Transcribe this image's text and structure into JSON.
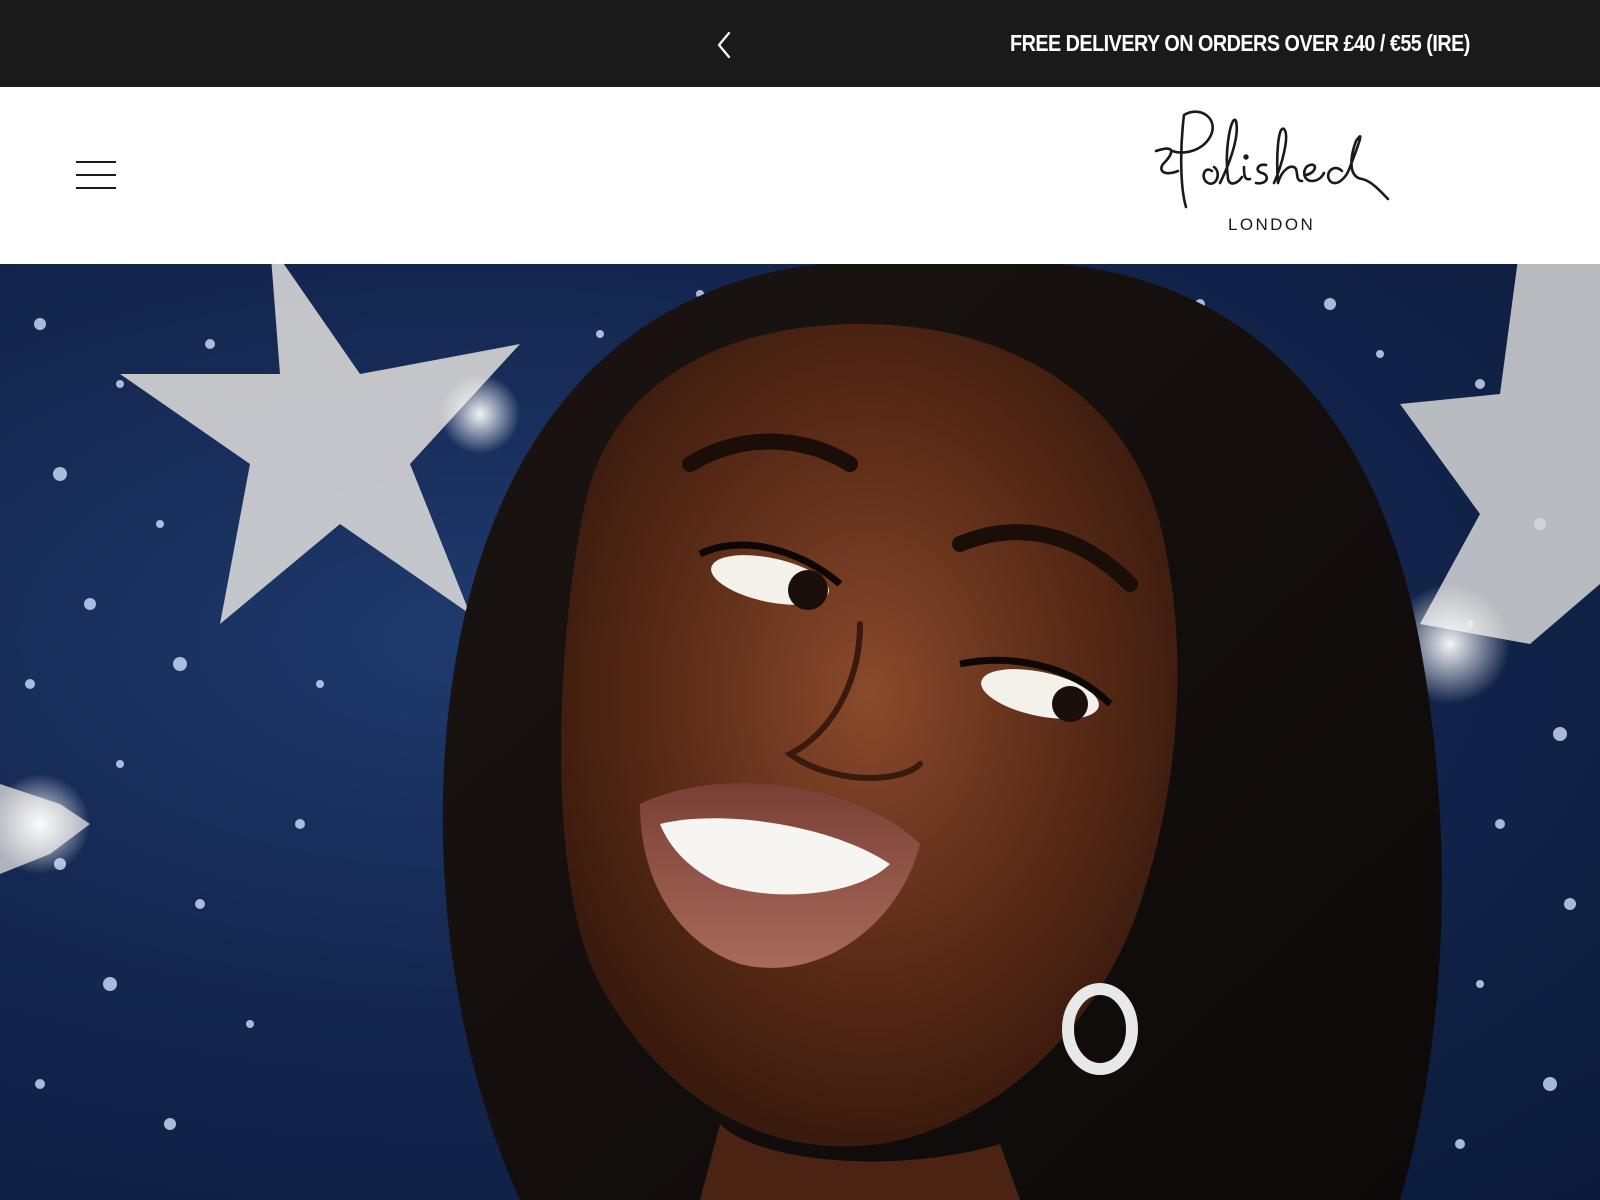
{
  "announcement": {
    "message": "FREE DELIVERY ON ORDERS OVER £40 / €55 (IRE)",
    "prev_icon": "chevron-left-icon"
  },
  "header": {
    "menu_icon": "hamburger-menu-icon",
    "logo": {
      "script_text": "Polished",
      "sub_text": "LONDON"
    }
  },
  "hero": {
    "image_alt": "Model smiling in front of glittery navy background with silver stars"
  },
  "colors": {
    "announcement_bg": "#1a1a1a",
    "announcement_text": "#ffffff",
    "header_bg": "#ffffff",
    "hero_navy": "#142750",
    "star_silver": "#d9d9d9"
  }
}
